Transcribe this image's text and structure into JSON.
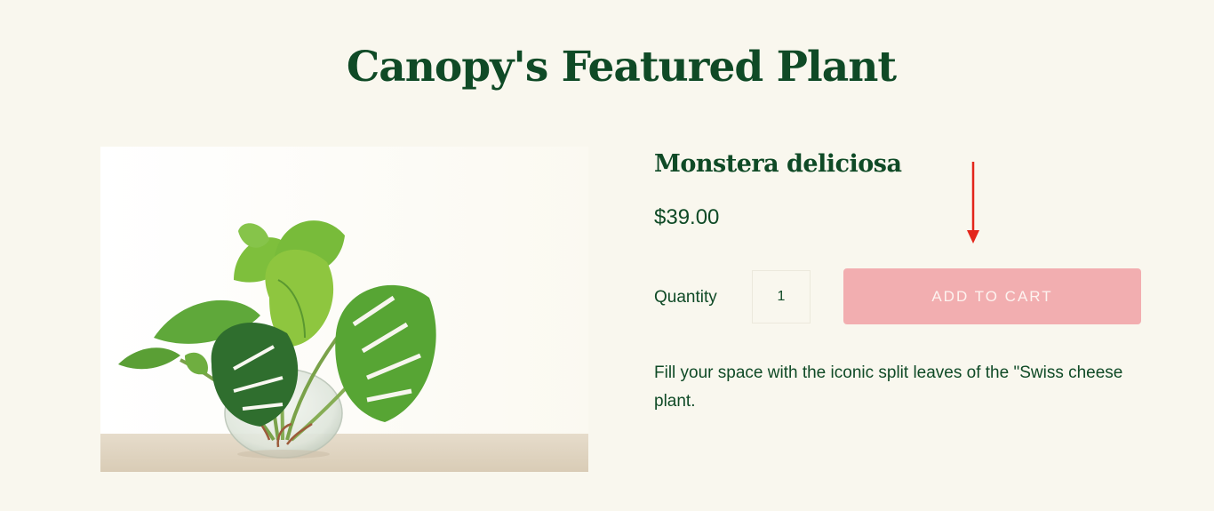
{
  "section": {
    "title": "Canopy's Featured Plant"
  },
  "product": {
    "image_alt": "Monstera deliciosa in glass vase",
    "name": "Monstera deliciosa",
    "price": "$39.00",
    "quantity_label": "Quantity",
    "quantity_value": "1",
    "add_to_cart_label": "ADD TO CART",
    "description": "Fill your space with the iconic split leaves of the \"Swiss cheese plant."
  },
  "colors": {
    "background": "#f9f7ee",
    "text_green": "#0f4a26",
    "button_pink": "#f2aeb0",
    "annotation_red": "#e3261b"
  }
}
